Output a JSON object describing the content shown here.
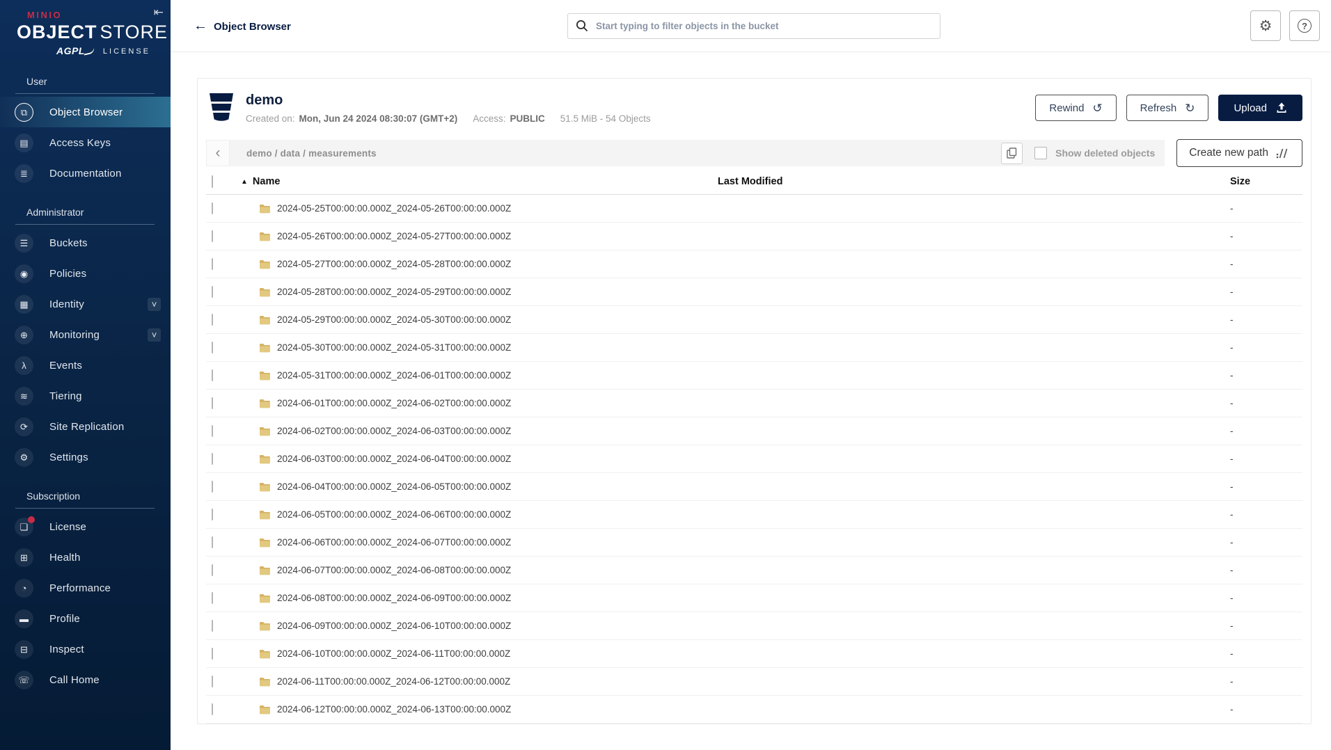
{
  "brand": {
    "minio": "MINIO",
    "product_word1": "OBJECT",
    "product_word2": "STORE",
    "license_badge": "AGPL",
    "license_word": "LICENSE"
  },
  "header": {
    "title": "Object Browser",
    "search_placeholder": "Start typing to filter objects in the bucket"
  },
  "sidebar": {
    "sections": [
      {
        "label": "User",
        "items": [
          {
            "label": "Object Browser",
            "icon": "object-browser-icon",
            "active": true
          },
          {
            "label": "Access Keys",
            "icon": "access-keys-icon"
          },
          {
            "label": "Documentation",
            "icon": "documentation-icon"
          }
        ]
      },
      {
        "label": "Administrator",
        "items": [
          {
            "label": "Buckets",
            "icon": "buckets-icon"
          },
          {
            "label": "Policies",
            "icon": "policies-icon"
          },
          {
            "label": "Identity",
            "icon": "identity-icon",
            "expandable": true
          },
          {
            "label": "Monitoring",
            "icon": "monitoring-icon",
            "expandable": true
          },
          {
            "label": "Events",
            "icon": "events-icon"
          },
          {
            "label": "Tiering",
            "icon": "tiering-icon"
          },
          {
            "label": "Site Replication",
            "icon": "site-replication-icon"
          },
          {
            "label": "Settings",
            "icon": "settings-icon"
          }
        ]
      },
      {
        "label": "Subscription",
        "items": [
          {
            "label": "License",
            "icon": "license-icon",
            "badge_dot": true
          },
          {
            "label": "Health",
            "icon": "health-icon"
          },
          {
            "label": "Performance",
            "icon": "performance-icon"
          },
          {
            "label": "Profile",
            "icon": "profile-icon"
          },
          {
            "label": "Inspect",
            "icon": "inspect-icon"
          },
          {
            "label": "Call Home",
            "icon": "call-home-icon"
          }
        ]
      }
    ]
  },
  "bucket": {
    "name": "demo",
    "created_label": "Created on:",
    "created_value": "Mon, Jun 24 2024 08:30:07 (GMT+2)",
    "access_label": "Access:",
    "access_value": "PUBLIC",
    "usage": "51.5 MiB - 54 Objects",
    "actions": {
      "rewind": "Rewind",
      "refresh": "Refresh",
      "upload": "Upload"
    }
  },
  "browser": {
    "breadcrumb": "demo / data / measurements",
    "show_deleted_label": "Show deleted objects",
    "create_path_label": "Create new path"
  },
  "table": {
    "columns": [
      "Name",
      "Last Modified",
      "Size"
    ],
    "sorted_by": "Name",
    "sort_direction": "asc",
    "rows": [
      {
        "name": "2024-05-25T00:00:00.000Z_2024-05-26T00:00:00.000Z",
        "last_modified": "",
        "size": "-"
      },
      {
        "name": "2024-05-26T00:00:00.000Z_2024-05-27T00:00:00.000Z",
        "last_modified": "",
        "size": "-"
      },
      {
        "name": "2024-05-27T00:00:00.000Z_2024-05-28T00:00:00.000Z",
        "last_modified": "",
        "size": "-"
      },
      {
        "name": "2024-05-28T00:00:00.000Z_2024-05-29T00:00:00.000Z",
        "last_modified": "",
        "size": "-"
      },
      {
        "name": "2024-05-29T00:00:00.000Z_2024-05-30T00:00:00.000Z",
        "last_modified": "",
        "size": "-"
      },
      {
        "name": "2024-05-30T00:00:00.000Z_2024-05-31T00:00:00.000Z",
        "last_modified": "",
        "size": "-"
      },
      {
        "name": "2024-05-31T00:00:00.000Z_2024-06-01T00:00:00.000Z",
        "last_modified": "",
        "size": "-"
      },
      {
        "name": "2024-06-01T00:00:00.000Z_2024-06-02T00:00:00.000Z",
        "last_modified": "",
        "size": "-"
      },
      {
        "name": "2024-06-02T00:00:00.000Z_2024-06-03T00:00:00.000Z",
        "last_modified": "",
        "size": "-"
      },
      {
        "name": "2024-06-03T00:00:00.000Z_2024-06-04T00:00:00.000Z",
        "last_modified": "",
        "size": "-"
      },
      {
        "name": "2024-06-04T00:00:00.000Z_2024-06-05T00:00:00.000Z",
        "last_modified": "",
        "size": "-"
      },
      {
        "name": "2024-06-05T00:00:00.000Z_2024-06-06T00:00:00.000Z",
        "last_modified": "",
        "size": "-"
      },
      {
        "name": "2024-06-06T00:00:00.000Z_2024-06-07T00:00:00.000Z",
        "last_modified": "",
        "size": "-"
      },
      {
        "name": "2024-06-07T00:00:00.000Z_2024-06-08T00:00:00.000Z",
        "last_modified": "",
        "size": "-"
      },
      {
        "name": "2024-06-08T00:00:00.000Z_2024-06-09T00:00:00.000Z",
        "last_modified": "",
        "size": "-"
      },
      {
        "name": "2024-06-09T00:00:00.000Z_2024-06-10T00:00:00.000Z",
        "last_modified": "",
        "size": "-"
      },
      {
        "name": "2024-06-10T00:00:00.000Z_2024-06-11T00:00:00.000Z",
        "last_modified": "",
        "size": "-"
      },
      {
        "name": "2024-06-11T00:00:00.000Z_2024-06-12T00:00:00.000Z",
        "last_modified": "",
        "size": "-"
      },
      {
        "name": "2024-06-12T00:00:00.000Z_2024-06-13T00:00:00.000Z",
        "last_modified": "",
        "size": "-"
      }
    ]
  },
  "colors": {
    "brand_red": "#C72C48",
    "accent_navy": "#081C42",
    "active_item_gradient_end": "#2C6F92",
    "folder_icon": "#DFC37C"
  },
  "icon_glyphs": {
    "object-browser-icon": "⧉",
    "access-keys-icon": "▤",
    "documentation-icon": "≣",
    "buckets-icon": "☰",
    "policies-icon": "◉",
    "identity-icon": "▦",
    "monitoring-icon": "⊕",
    "events-icon": "λ",
    "tiering-icon": "≋",
    "site-replication-icon": "⟳",
    "settings-icon": "⚙",
    "license-icon": "❏",
    "health-icon": "⊞",
    "performance-icon": "◔",
    "profile-icon": "▬",
    "inspect-icon": "⊟",
    "call-home-icon": "☏"
  }
}
